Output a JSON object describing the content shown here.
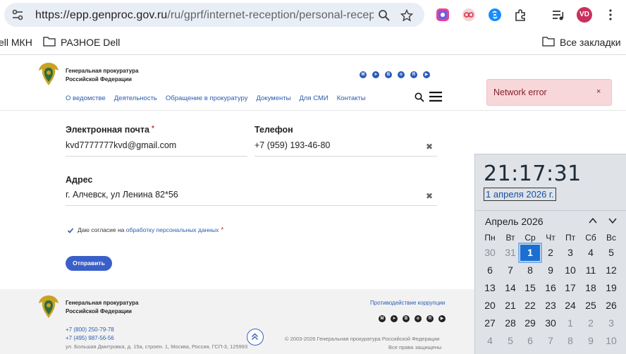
{
  "browser": {
    "url_main": "https://epp.genproc.gov.ru",
    "url_path": "/ru/gprf/internet-reception/personal-receptionr...",
    "avatar_initials": "VD",
    "bookmarks": [
      "ell МКН",
      "РАЗНОЕ Dell"
    ],
    "all_bookmarks": "Все закладки"
  },
  "site": {
    "org_line1": "Генеральная прокуратура",
    "org_line2": "Российской Федерации",
    "nav": [
      "О ведомстве",
      "Деятельность",
      "Обращение в прокуратуру",
      "Документы",
      "Для СМИ",
      "Контакты"
    ],
    "social_icons": [
      "max-icon",
      "telegram-icon",
      "vk-icon",
      "ok-icon",
      "rutube-icon",
      "youtube-icon"
    ]
  },
  "toast": {
    "message": "Network error",
    "close": "×"
  },
  "form": {
    "email_label": "Электронная почта",
    "email_value": "kvd7777777kvd@gmail.com",
    "phone_label": "Телефон",
    "phone_value": "+7 (959) 193-46-80",
    "address_label": "Адрес",
    "address_value": "г. Алчевск, ул Ленина 82*56",
    "required_mark": "*",
    "clear": "✖",
    "consent_prefix": "Даю согласие на",
    "consent_link": "обработку персональных данных",
    "submit": "Отправить",
    "consent_checked": true
  },
  "footer": {
    "org_line1": "Генеральная прокуратура",
    "org_line2": "Российской Федерации",
    "corruption_link": "Противодействие коррупции",
    "phone1": "+7 (800) 250-79-78",
    "phone2": "+7 (495) 987-56-56",
    "address": "ул. Большая Дмитровка, д. 15а, строен. 1, Москва, Россия, ГСП-3, 125993",
    "copyright": "© 2003-2026 Генеральная прокуратура Российской Федерации",
    "rights": "Все права защищены"
  },
  "flyout": {
    "time": "21:17:31",
    "date": "1 апреля 2026 г.",
    "month": "Апрель 2026",
    "weekdays": [
      "Пн",
      "Вт",
      "Ср",
      "Чт",
      "Пт",
      "Сб",
      "Вс"
    ],
    "weeks": [
      [
        "30",
        "31",
        "1",
        "2",
        "3",
        "4",
        "5"
      ],
      [
        "6",
        "7",
        "8",
        "9",
        "10",
        "11",
        "12"
      ],
      [
        "13",
        "14",
        "15",
        "16",
        "17",
        "18",
        "19"
      ],
      [
        "20",
        "21",
        "22",
        "23",
        "24",
        "25",
        "26"
      ],
      [
        "27",
        "28",
        "29",
        "30",
        "1",
        "2",
        "3"
      ],
      [
        "4",
        "5",
        "6",
        "7",
        "8",
        "9",
        "10"
      ]
    ],
    "today": "1"
  },
  "colors": {
    "accent": "#3b5fc8",
    "link": "#2a5db0",
    "toast_bg": "#f8d7da",
    "today": "#1a6fd1"
  }
}
